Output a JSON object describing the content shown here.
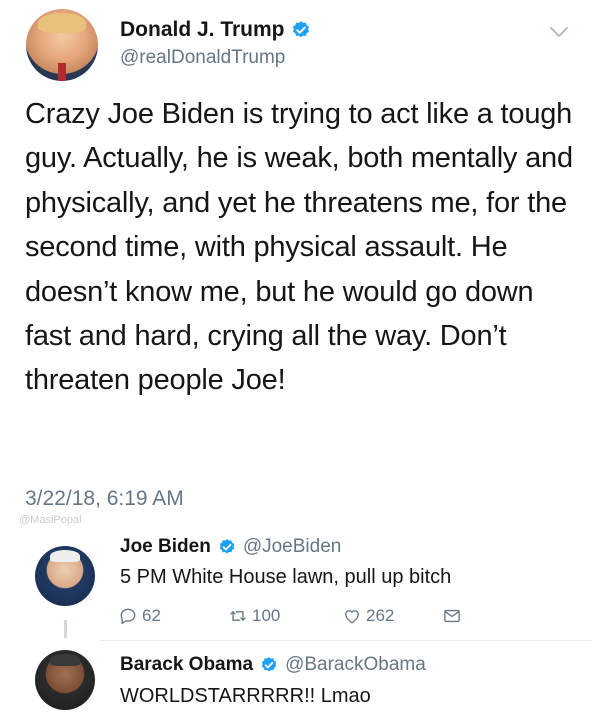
{
  "main_tweet": {
    "display_name": "Donald J. Trump",
    "handle": "@realDonaldTrump",
    "text": "Crazy Joe Biden is trying to act like a tough guy. Actually, he is weak, both mentally and physically, and yet he threatens me, for the second time, with physical assault. He doesn’t know me, but he would go down fast and hard, crying all the way. Don’t threaten people Joe!",
    "timestamp": "3/22/18, 6:19 AM",
    "watermark": "@MasiPopal"
  },
  "replies": [
    {
      "display_name": "Joe Biden",
      "handle": "@JoeBiden",
      "text": "5 PM White House lawn, pull up bitch",
      "reply_count": "62",
      "retweet_count": "100",
      "like_count": "262"
    },
    {
      "display_name": "Barack Obama",
      "handle": "@BarackObama",
      "text": "WORLDSTARRRRR!! Lmao"
    }
  ],
  "colors": {
    "verified_blue": "#1da1f2",
    "secondary_text": "#657786",
    "primary_text": "#14171a"
  },
  "icons": [
    "verified-badge-icon",
    "chevron-down-icon",
    "reply-icon",
    "retweet-icon",
    "like-icon",
    "direct-message-icon"
  ]
}
